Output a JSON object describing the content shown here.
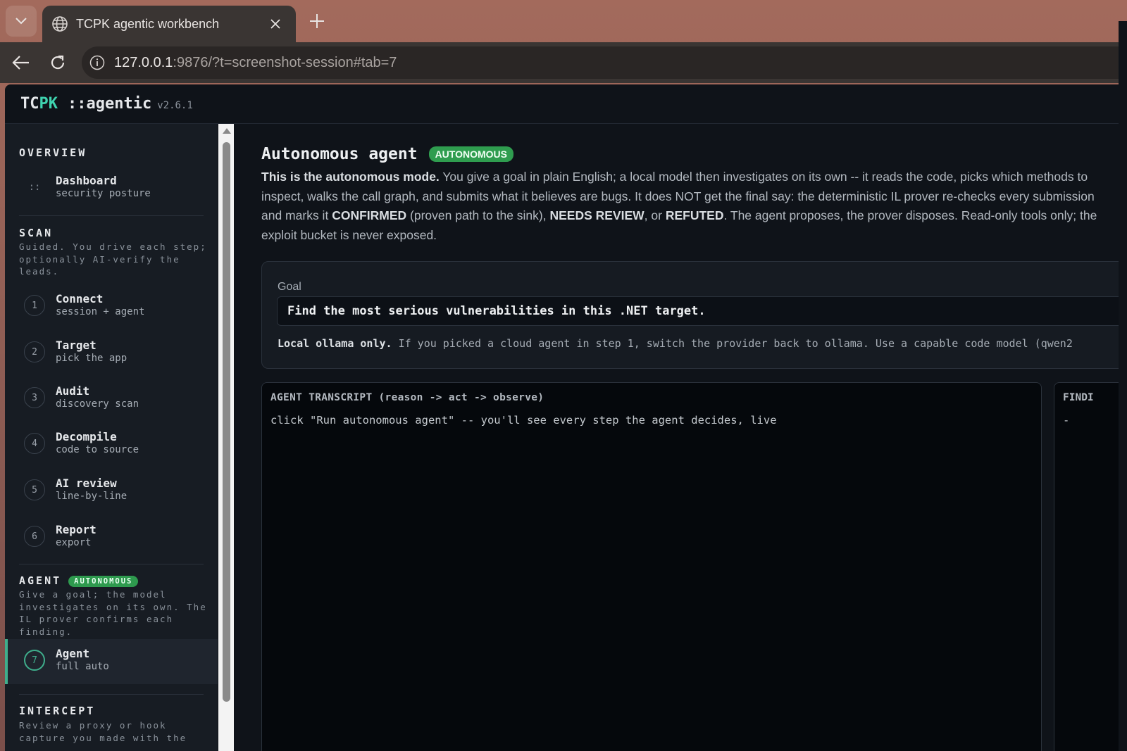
{
  "browser": {
    "tab_title": "TCPK agentic workbench",
    "url_host": "127.0.0.1",
    "url_rest": ":9876/?t=screenshot-session#tab=7"
  },
  "app": {
    "brand_tc": "TC",
    "brand_pk": "PK",
    "brand_name": "::agentic",
    "version": "v2.6.1"
  },
  "sidebar": {
    "overview": {
      "title": "OVERVIEW",
      "items": [
        {
          "icon": "::",
          "label": "Dashboard",
          "sub": "security posture"
        }
      ]
    },
    "scan": {
      "title": "SCAN",
      "desc": "Guided. You drive each step; optionally AI-verify the leads.",
      "items": [
        {
          "num": "1",
          "label": "Connect",
          "sub": "session + agent"
        },
        {
          "num": "2",
          "label": "Target",
          "sub": "pick the app"
        },
        {
          "num": "3",
          "label": "Audit",
          "sub": "discovery scan"
        },
        {
          "num": "4",
          "label": "Decompile",
          "sub": "code to source"
        },
        {
          "num": "5",
          "label": "AI review",
          "sub": "line-by-line"
        },
        {
          "num": "6",
          "label": "Report",
          "sub": "export"
        }
      ]
    },
    "agent": {
      "title": "AGENT",
      "badge": "AUTONOMOUS",
      "desc": "Give a goal; the model investigates on its own. The IL prover confirms each finding.",
      "items": [
        {
          "num": "7",
          "label": "Agent",
          "sub": "full auto"
        }
      ]
    },
    "intercept": {
      "title": "INTERCEPT",
      "desc": "Review a proxy or hook capture you made with the"
    }
  },
  "main": {
    "title": "Autonomous agent",
    "badge": "AUTONOMOUS",
    "intro": {
      "b1": "This is the autonomous mode.",
      "t1": " You give a goal in plain English; a local model then investigates on its own -- it reads the code, picks which methods to inspect, walks the call graph, and submits what it believes are bugs. It does NOT get the final say: the deterministic IL prover re-checks every submission and marks it ",
      "b2": "CONFIRMED",
      "t2": " (proven path to the sink), ",
      "b3": "NEEDS REVIEW",
      "t3": ", or ",
      "b4": "REFUTED",
      "t4": ". The agent proposes, the prover disposes. Read-only tools only; the exploit bucket is never exposed."
    },
    "goal": {
      "label": "Goal",
      "value": "Find the most serious vulnerabilities in this .NET target.",
      "note_bold": "Local ollama only.",
      "note_rest": " If you picked a cloud agent in step 1, switch the provider back to ollama. Use a capable code model (qwen2"
    },
    "transcript": {
      "header": "AGENT TRANSCRIPT (reason -> act -> observe)",
      "message": "click \"Run autonomous agent\" -- you'll see every step the agent decides, live"
    },
    "findings": {
      "header": "FINDI",
      "message": "-"
    }
  },
  "colors": {
    "accent_teal": "#3fd4b0",
    "badge_green": "#2f9d4f",
    "active_green": "#3fae8c",
    "background": "#0f1319"
  }
}
